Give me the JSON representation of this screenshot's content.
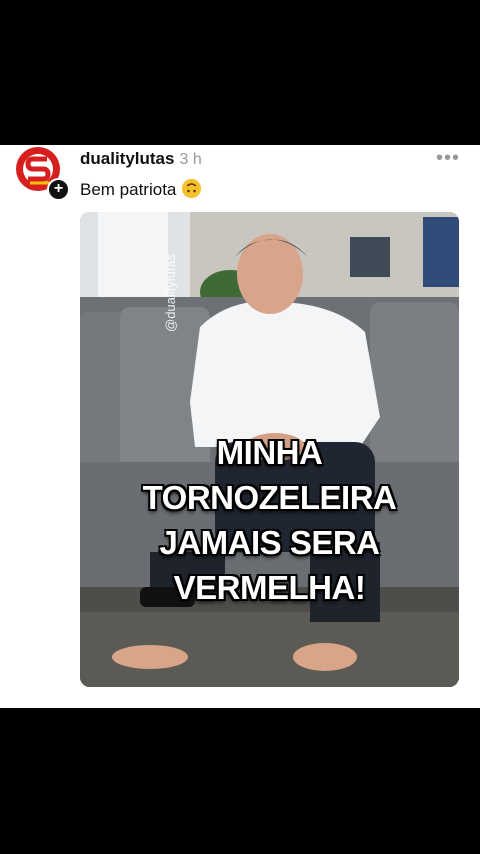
{
  "post": {
    "username": "dualitylutas",
    "time": "3 h",
    "caption": "Bem patriota",
    "caption_emoji": "upside-down-face",
    "more_icon": "more-horizontal-icon",
    "avatar_badge_icon": "plus-icon"
  },
  "image": {
    "overlay_lines": [
      "MINHA",
      "TORNOZELEIRA",
      "JAMAIS SERA",
      "VERMELHA!"
    ],
    "watermark": "@dualitylutas"
  },
  "colors": {
    "page_bg": "#000000",
    "card_bg": "#ffffff",
    "logo_red": "#d62020",
    "logo_yellow": "#f2c000"
  }
}
